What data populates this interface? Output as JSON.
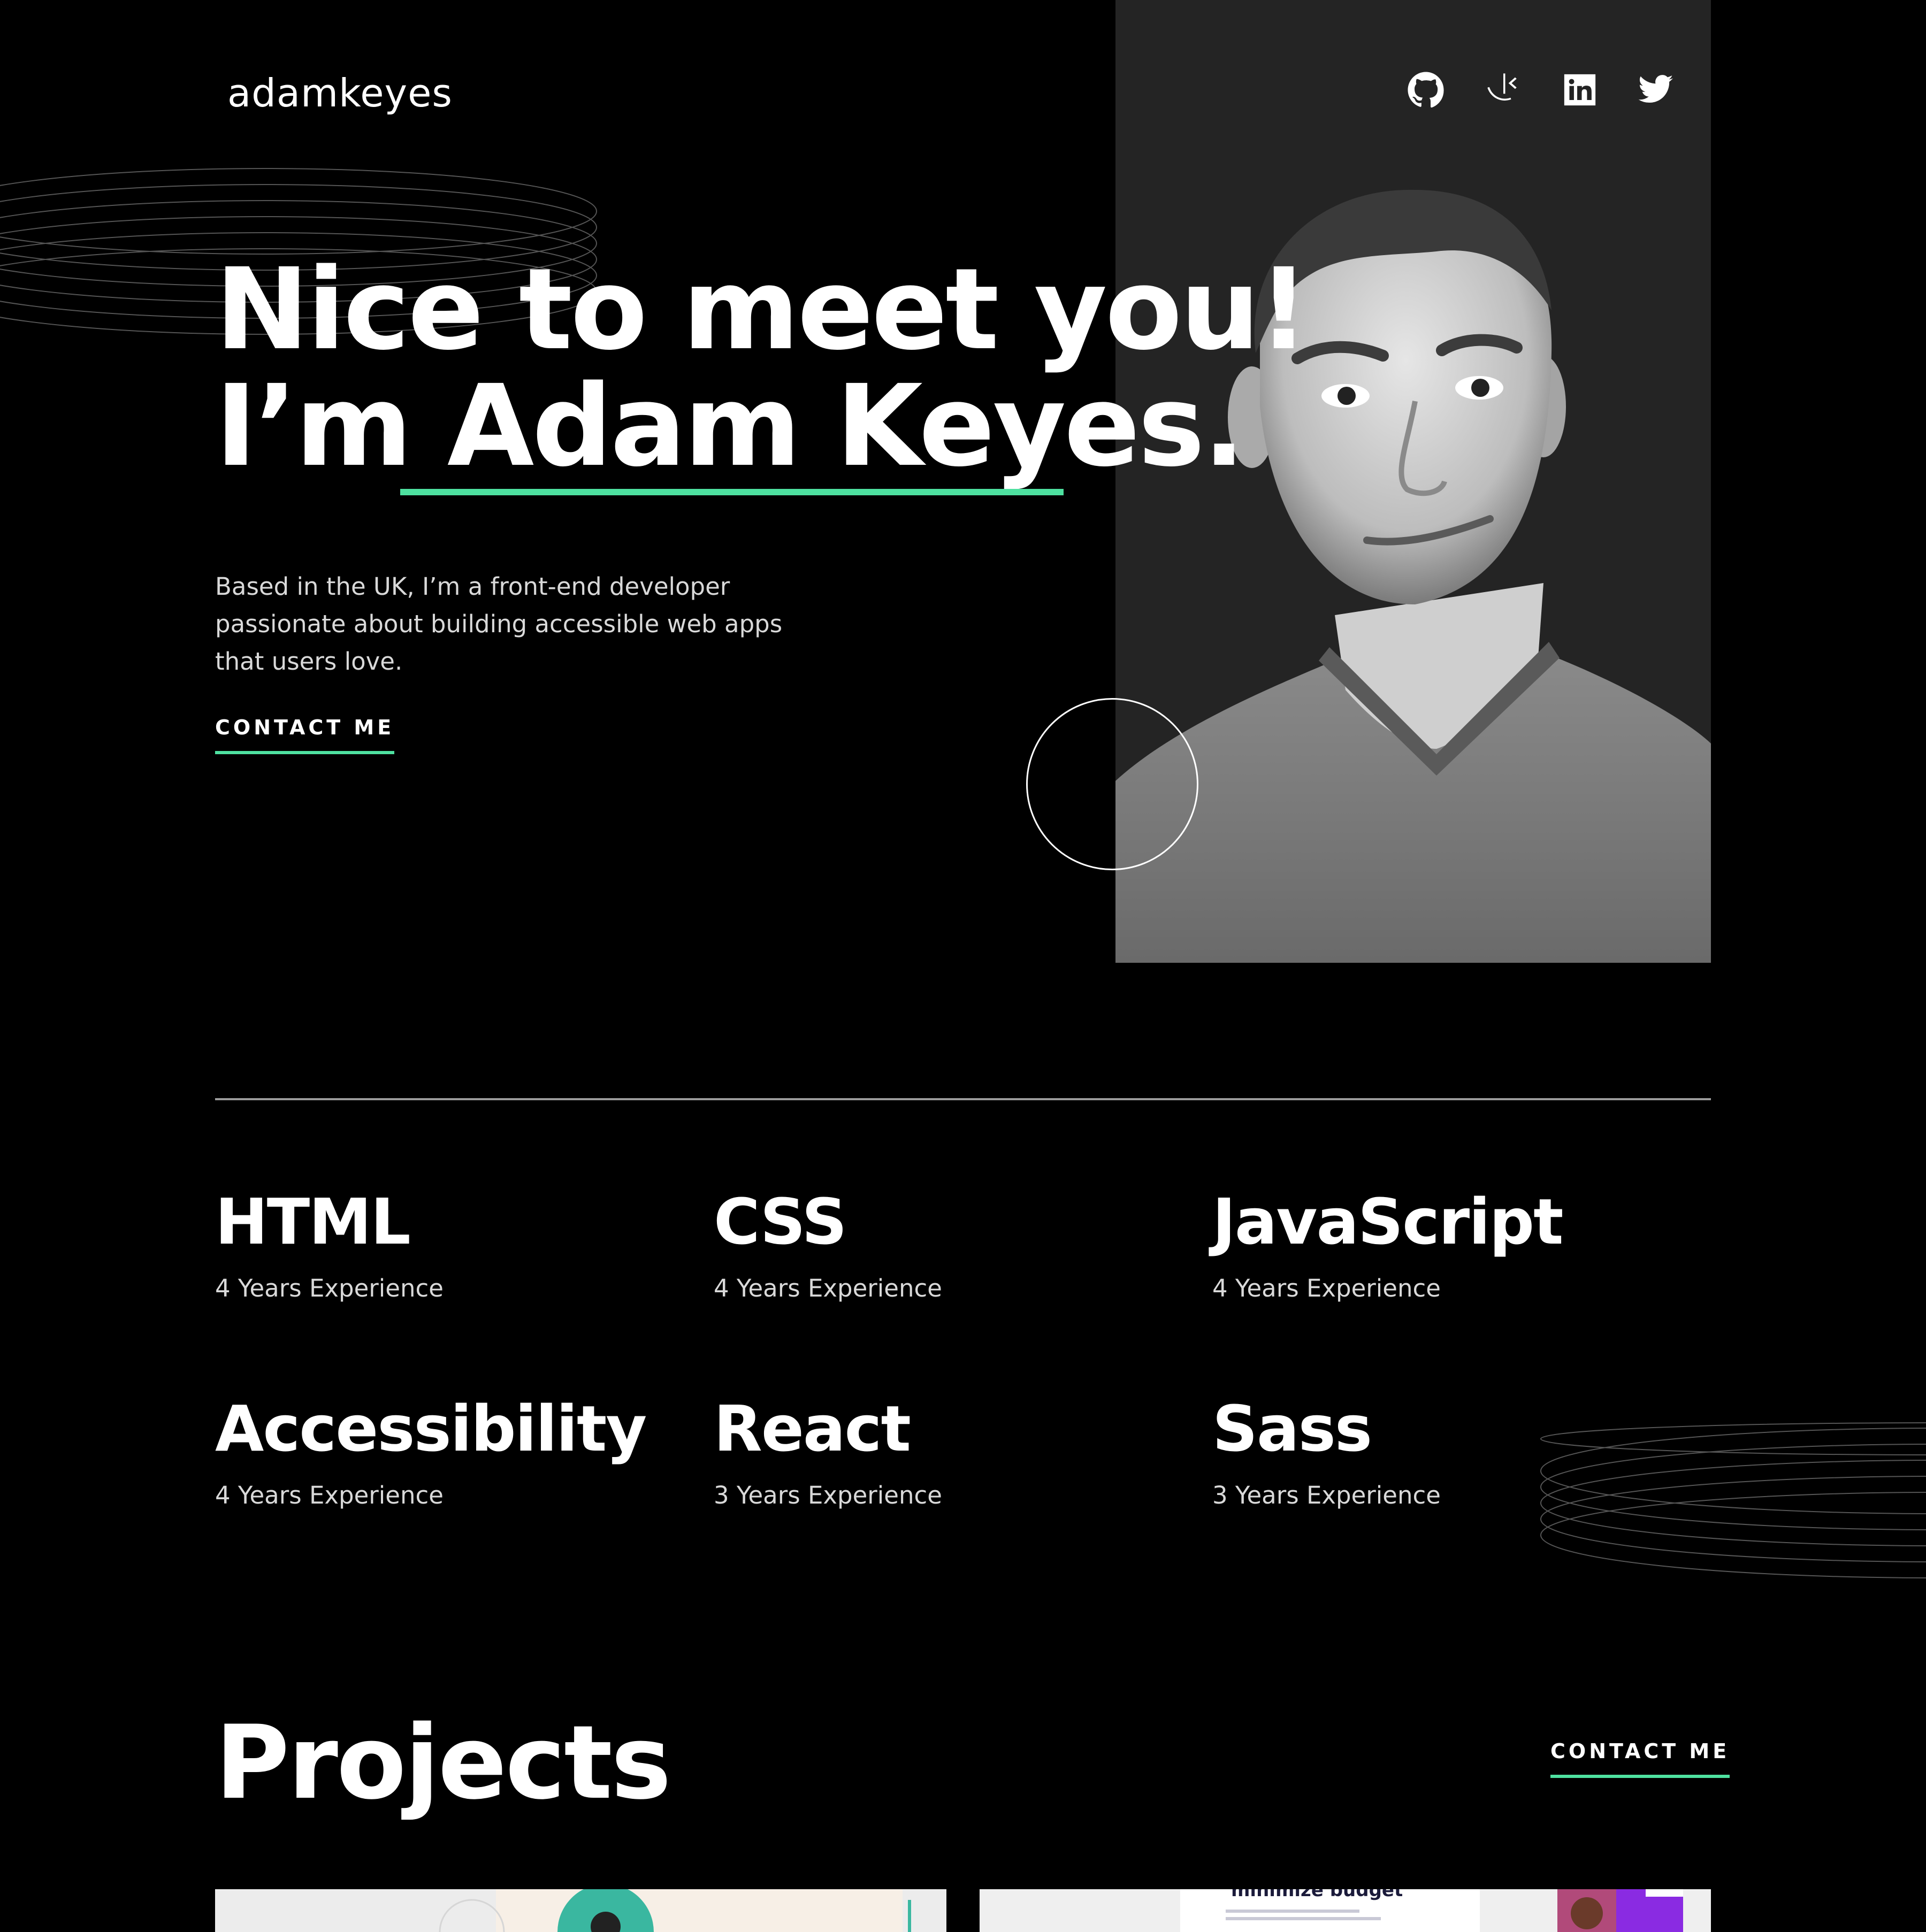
{
  "header": {
    "logo": "adamkeyes",
    "social": [
      {
        "name": "github-icon"
      },
      {
        "name": "frontend-mentor-icon"
      },
      {
        "name": "linkedin-icon"
      },
      {
        "name": "twitter-icon"
      }
    ]
  },
  "hero": {
    "title_line1": "Nice to meet you!",
    "title_line2_prefix": "I’m ",
    "title_line2_name": "Adam Keyes",
    "title_line2_suffix": ".",
    "description": "Based in the UK, I’m a front-end developer passionate about building accessible web apps that users love.",
    "cta_label": "CONTACT ME"
  },
  "skills": [
    {
      "name": "HTML",
      "experience": "4 Years Experience"
    },
    {
      "name": "CSS",
      "experience": "4 Years Experience"
    },
    {
      "name": "JavaScript",
      "experience": "4 Years Experience"
    },
    {
      "name": "Accessibility",
      "experience": "4 Years Experience"
    },
    {
      "name": "React",
      "experience": "3 Years Experience"
    },
    {
      "name": "Sass",
      "experience": "3 Years Experience"
    }
  ],
  "projects": {
    "title": "Projects",
    "cta_label": "CONTACT ME",
    "thumb2_caption": "minimize budget"
  },
  "colors": {
    "accent": "#4ee1a0",
    "background": "#000000",
    "photo_panel": "#242424",
    "text_secondary": "#d9d9d9"
  }
}
